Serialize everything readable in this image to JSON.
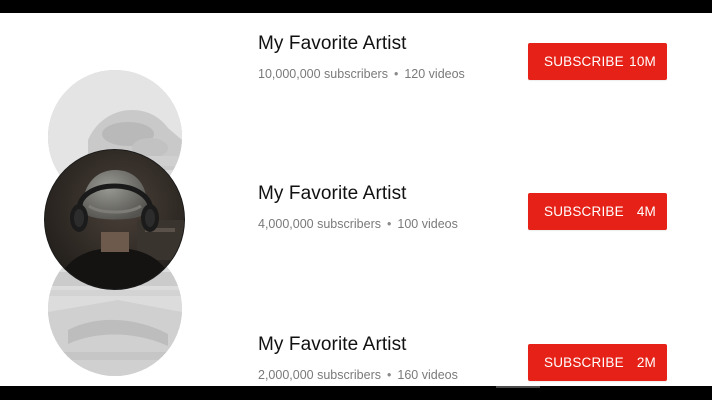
{
  "colors": {
    "subscribe_bg": "#e62117",
    "text_primary": "#111111",
    "text_secondary": "#7a7a7a"
  },
  "channels": [
    {
      "name": "My Favorite Artist",
      "subscribers": "10,000,000 subscribers",
      "videos": "120 videos",
      "subscribe_label": "SUBSCRIBE",
      "subscribe_count": "10M",
      "avatar_state": "faded"
    },
    {
      "name": "My Favorite Artist",
      "subscribers": "4,000,000 subscribers",
      "videos": "100 videos",
      "subscribe_label": "SUBSCRIBE",
      "subscribe_count": "4M",
      "avatar_state": "active"
    },
    {
      "name": "My Favorite Artist",
      "subscribers": "2,000,000 subscribers",
      "videos": "160 videos",
      "subscribe_label": "SUBSCRIBE",
      "subscribe_count": "2M",
      "avatar_state": "faded"
    }
  ],
  "separator": "•"
}
